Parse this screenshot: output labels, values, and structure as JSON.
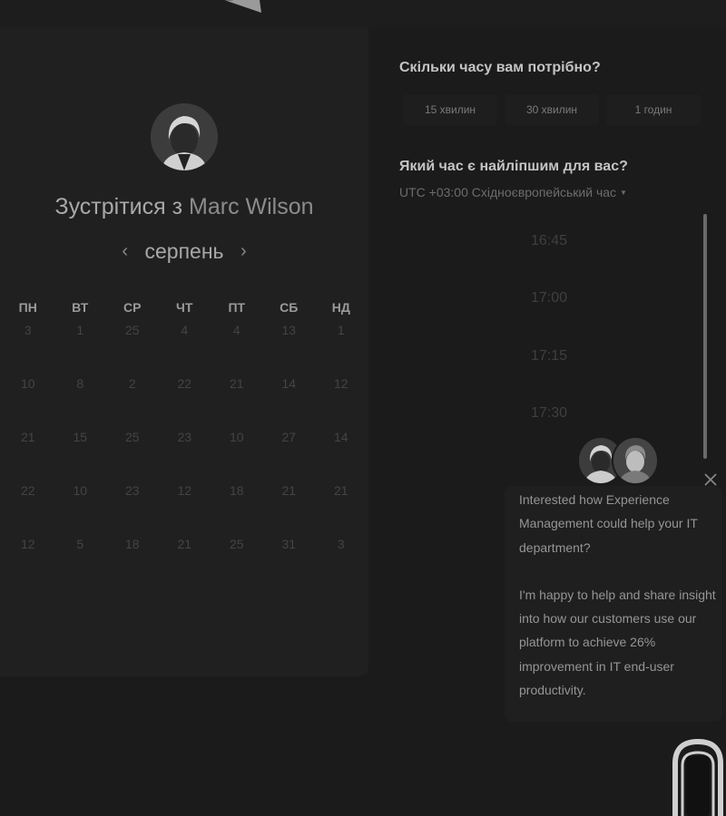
{
  "calendar": {
    "title_prefix": "Зустрітися з",
    "host_name": "Marc Wilson",
    "month": "серпень",
    "prev_icon": "chevron-left-icon",
    "next_icon": "chevron-right-icon",
    "weekdays": [
      "ПН",
      "ВТ",
      "СР",
      "ЧТ",
      "ПТ",
      "СБ",
      "НД"
    ],
    "weeks": [
      [
        "3",
        "1",
        "25",
        "4",
        "4",
        "13",
        "1"
      ],
      [
        "10",
        "8",
        "2",
        "22",
        "21",
        "14",
        "12"
      ],
      [
        "21",
        "15",
        "25",
        "23",
        "10",
        "27",
        "14"
      ],
      [
        "22",
        "10",
        "23",
        "12",
        "18",
        "21",
        "21"
      ],
      [
        "12",
        "5",
        "18",
        "21",
        "25",
        "31",
        "3"
      ]
    ]
  },
  "scheduler": {
    "duration_question": "Скільки часу вам потрібно?",
    "durations": [
      "15 хвилин",
      "30 хвилин",
      "1 годин"
    ],
    "time_question": "Який час є найліпшим для вас?",
    "timezone": "UTC +03:00 Східноєвропейський час",
    "slots": [
      "16:45",
      "17:00",
      "17:15",
      "17:30"
    ]
  },
  "chat": {
    "paragraphs": [
      "Interested how Experience Management could help your IT department?",
      "I'm happy to help and share insight into how our customers use our platform to achieve 26% improvement in IT end-user productivity."
    ],
    "close_icon": "close-icon",
    "launcher_icon": "chat-launcher-icon"
  },
  "colors": {
    "page_background": "#1b1b1b",
    "panel_background": "#202020",
    "heading_text": "#c4c4c4",
    "muted_text": "#444444"
  }
}
